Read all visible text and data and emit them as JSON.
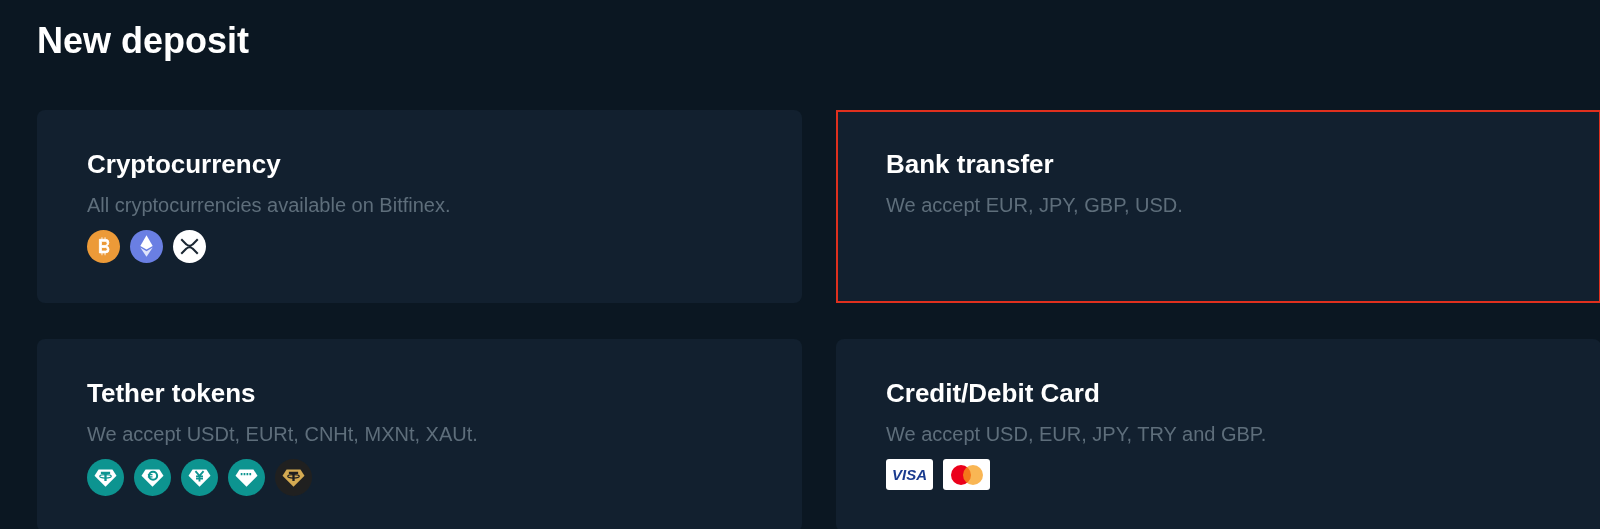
{
  "page": {
    "title": "New deposit"
  },
  "methods": [
    {
      "title": "Cryptocurrency",
      "description": "All cryptocurrencies available on Bitfinex.",
      "selected": false,
      "icons": [
        {
          "kind": "btc"
        },
        {
          "kind": "eth"
        },
        {
          "kind": "xrp"
        }
      ]
    },
    {
      "title": "Bank transfer",
      "description": "We accept EUR, JPY, GBP, USD.",
      "selected": true
    },
    {
      "title": "Tether tokens",
      "description": "We accept USDt, EURt, CNHt, MXNt, XAUt.",
      "selected": false,
      "icons": [
        {
          "kind": "usdt"
        },
        {
          "kind": "eurt"
        },
        {
          "kind": "cnht"
        },
        {
          "kind": "mxnt"
        },
        {
          "kind": "xaut"
        }
      ]
    },
    {
      "title": "Credit/Debit Card",
      "description": "We accept USD, EUR, JPY, TRY and GBP.",
      "selected": false,
      "icons": [
        {
          "kind": "visa",
          "label": "VISA"
        },
        {
          "kind": "mastercard"
        }
      ]
    }
  ]
}
